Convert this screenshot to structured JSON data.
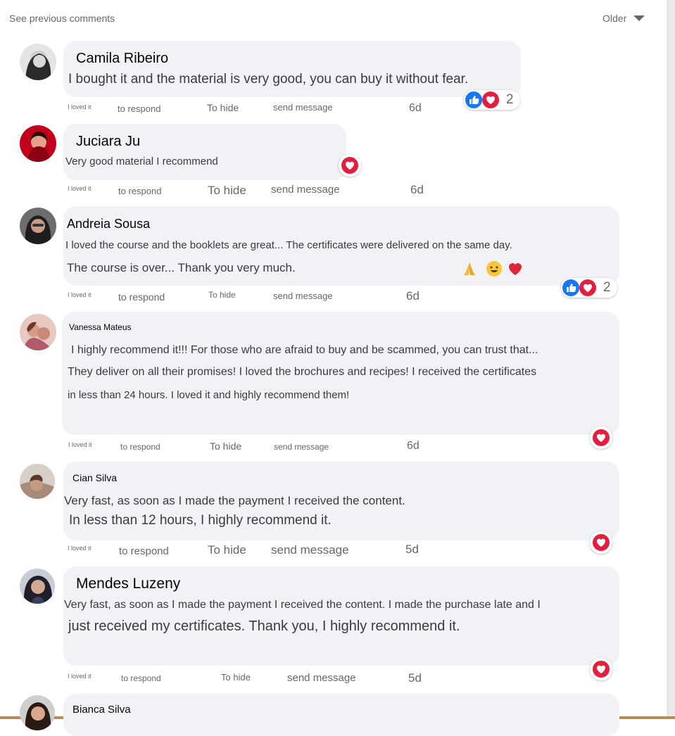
{
  "header": {
    "see_previous": "See previous comments",
    "sort_label": "Older"
  },
  "colors": {
    "bubble": "#f0f2f5",
    "like_blue": "#1877f2",
    "love_red": "#e41e3f",
    "muted_text": "#65676b"
  },
  "icons": {
    "like": "thumbs-up-icon",
    "love": "heart-icon",
    "pray": "folded-hands-emoji",
    "smile": "smiling-face-emoji"
  },
  "comments": [
    {
      "author": "Camila Ribeiro",
      "lines": [
        "I bought it and the material is very good, you can buy it without fear."
      ],
      "actions": {
        "reaction": "I loved it",
        "respond": "to respond",
        "hide": "To hide",
        "message": "send message",
        "time": "6d"
      },
      "reaction_count": "2"
    },
    {
      "author": "Juciara Ju",
      "lines": [
        "Very good material I recommend"
      ],
      "actions": {
        "reaction": "I loved it",
        "respond": "to respond",
        "hide": "To hide",
        "message": "send message",
        "time": "6d"
      }
    },
    {
      "author": "Andreia Sousa",
      "lines": [
        "I loved the course and the booklets are great... The certificates were delivered on the same day.",
        "The course is over... Thank you very much."
      ],
      "actions": {
        "reaction": "I loved it",
        "respond": "to respond",
        "hide": "To hide",
        "message": "send message",
        "time": "6d"
      },
      "reaction_count": "2"
    },
    {
      "author": "Vanessa Mateus",
      "lines": [
        "I highly recommend it!!! For those who are afraid to buy and be scammed, you can trust that...",
        "They deliver on all their promises! I loved the brochures and recipes! I received the certificates",
        "in less than 24 hours. I loved it and highly recommend them!"
      ],
      "actions": {
        "reaction": "I loved it",
        "respond": "to respond",
        "hide": "To hide",
        "message": "send message",
        "time": "6d"
      }
    },
    {
      "author": "Cian Silva",
      "lines": [
        "Very fast, as soon as I made the payment I received the content.",
        "In less than 12 hours, I highly recommend it."
      ],
      "actions": {
        "reaction": "I loved it",
        "respond": "to respond",
        "hide": "To hide",
        "message": "send message",
        "time": "5d"
      }
    },
    {
      "author": "Mendes Luzeny",
      "lines": [
        "Very fast, as soon as I made the payment I received the content. I made the purchase late and I",
        "just received my certificates. Thank you, I highly recommend it."
      ],
      "actions": {
        "reaction": "I loved it",
        "respond": "to respond",
        "hide": "To hide",
        "message": "send message",
        "time": "5d"
      }
    },
    {
      "author": "Bianca Silva",
      "lines": []
    }
  ]
}
